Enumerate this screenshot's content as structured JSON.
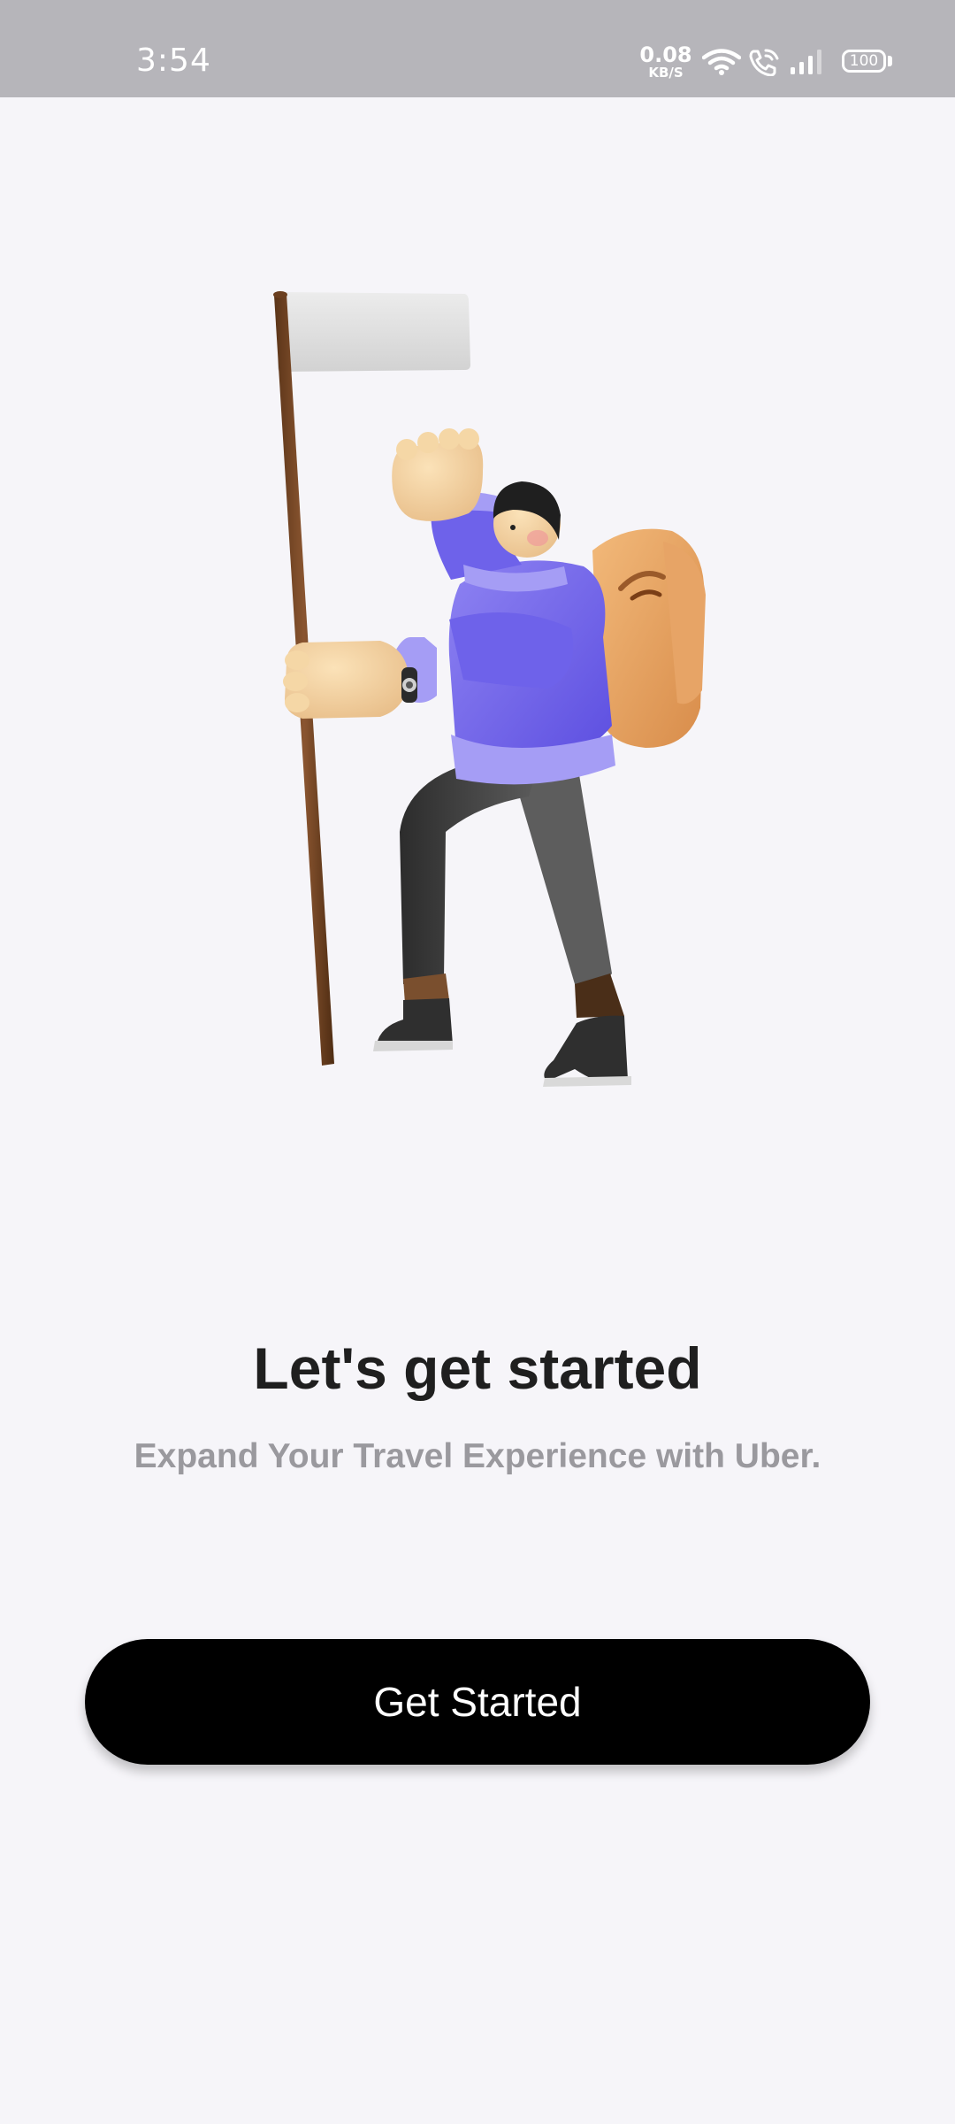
{
  "status_bar": {
    "time": "3:54",
    "speed_value": "0.08",
    "speed_unit": "KB/S",
    "battery": "100",
    "icons": [
      "wifi-icon",
      "wifi-call-icon",
      "signal-icon",
      "battery-icon"
    ]
  },
  "onboarding": {
    "illustration": "hiker-with-flag-illustration",
    "title": "Let's get started",
    "subtitle": "Expand Your Travel Experience with Uber.",
    "cta_label": "Get Started"
  },
  "colors": {
    "background": "#f6f5f9",
    "status_bar": "#b6b5ba",
    "button": "#000000",
    "title": "#1f1f1f",
    "subtitle": "#9a999e"
  }
}
